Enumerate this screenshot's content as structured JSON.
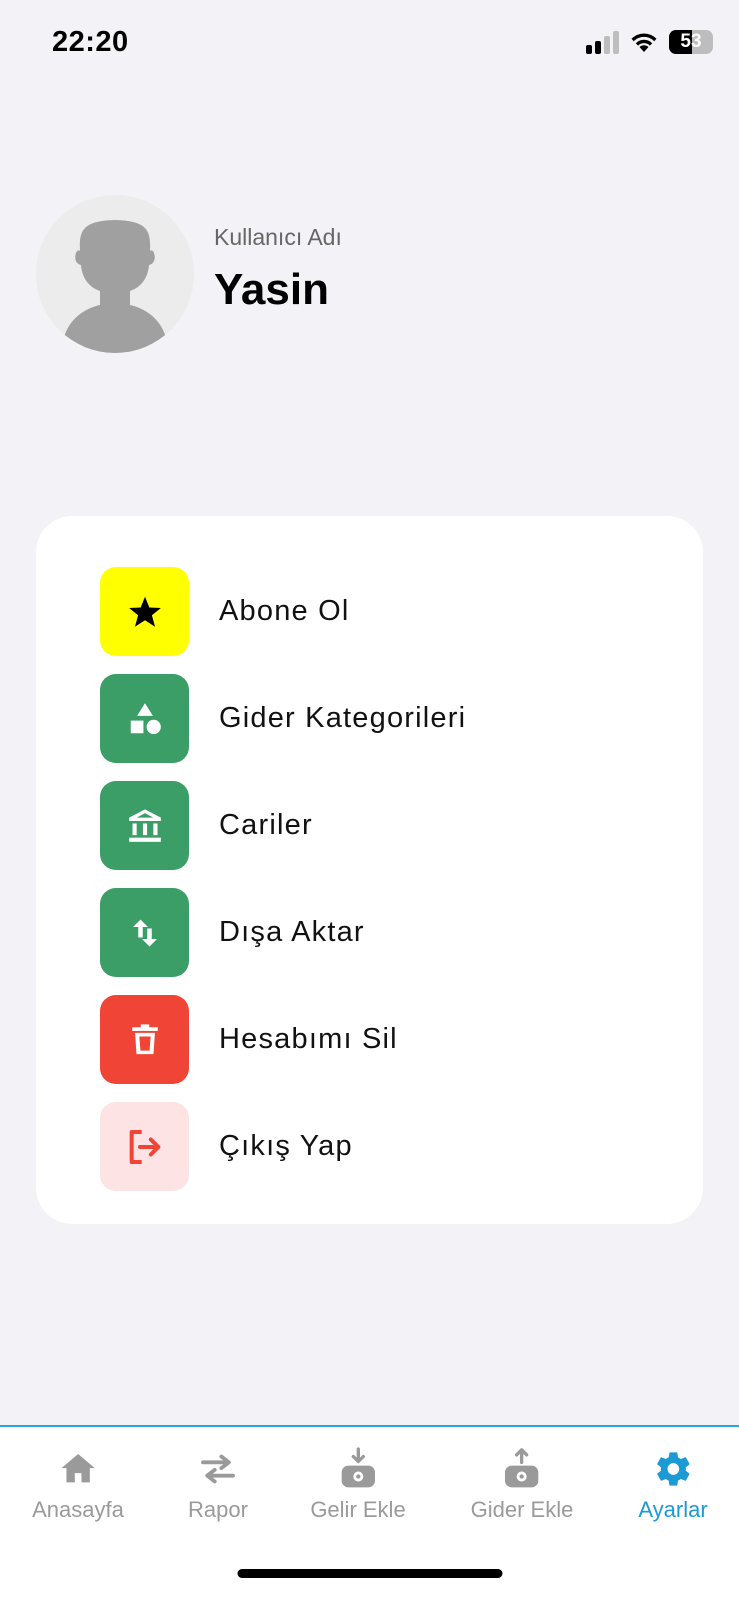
{
  "status_bar": {
    "time": "22:20",
    "battery_level": "53",
    "battery_fraction": 0.53
  },
  "profile": {
    "caption": "Kullanıcı Adı",
    "name": "Yasin"
  },
  "menu": {
    "items": [
      {
        "label": "Abone Ol",
        "icon": "star-icon",
        "bg": "#ffff00",
        "fg": "#000000"
      },
      {
        "label": "Gider Kategorileri",
        "icon": "shapes-icon",
        "bg": "#3a9e66",
        "fg": "#ffffff"
      },
      {
        "label": "Cariler",
        "icon": "bank-icon",
        "bg": "#3a9e66",
        "fg": "#ffffff"
      },
      {
        "label": "Dışa Aktar",
        "icon": "import-export-icon",
        "bg": "#3a9e66",
        "fg": "#ffffff"
      },
      {
        "label": "Hesabımı Sil",
        "icon": "trash-icon",
        "bg": "#f04436",
        "fg": "#ffffff"
      },
      {
        "label": "Çıkış Yap",
        "icon": "logout-icon",
        "bg": "#fde3e3",
        "fg": "#f04436"
      }
    ]
  },
  "tab_bar": {
    "tabs": [
      {
        "label": "Anasayfa",
        "icon": "home-icon"
      },
      {
        "label": "Rapor",
        "icon": "swap-arrows-icon"
      },
      {
        "label": "Gelir Ekle",
        "icon": "income-icon"
      },
      {
        "label": "Gider Ekle",
        "icon": "expense-icon"
      },
      {
        "label": "Ayarlar",
        "icon": "settings-gear-icon"
      }
    ],
    "active_index": 4,
    "active_color": "#1b9ad6",
    "inactive_color": "#9a9a9a"
  }
}
